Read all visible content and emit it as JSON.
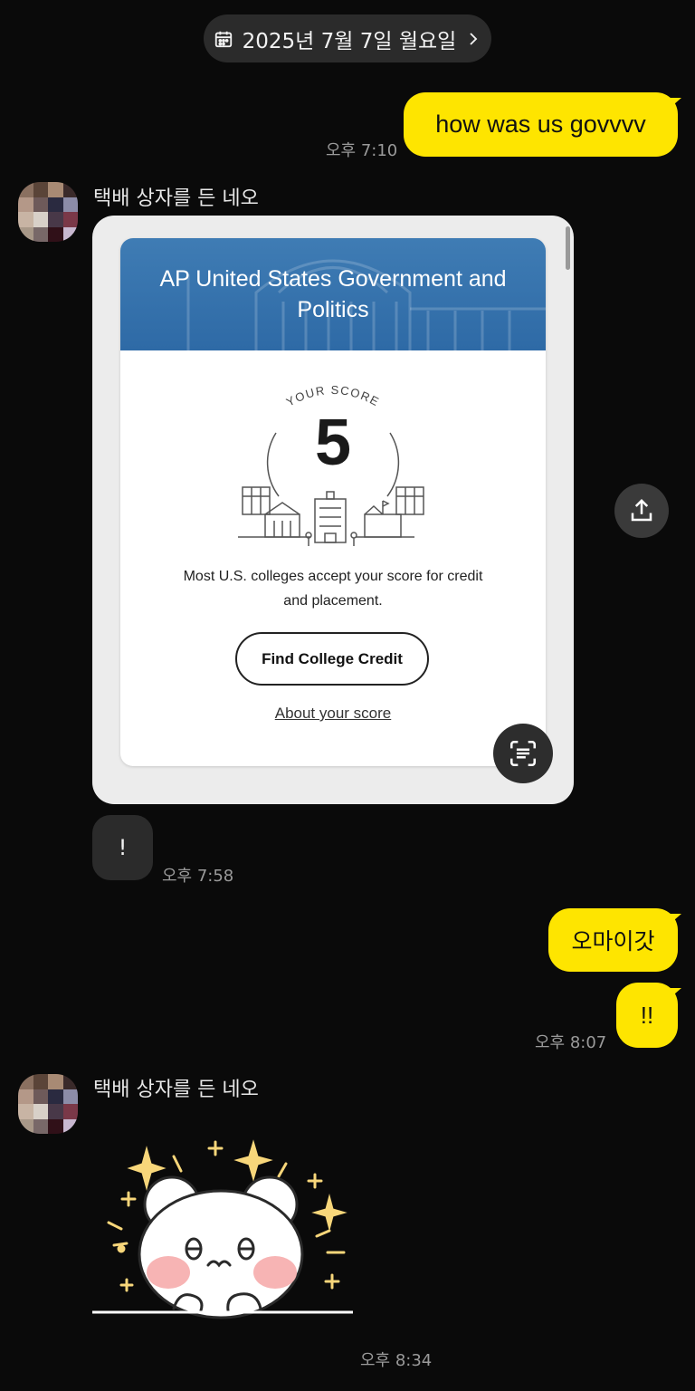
{
  "date_divider": {
    "label": "2025년 7월 7일 월요일",
    "icon": "calendar-icon",
    "chevron": "chevron-right-icon"
  },
  "messages": [
    {
      "type": "outgoing",
      "text": "how was us govvvv",
      "time": "오후 7:10"
    },
    {
      "type": "incoming-image",
      "sender": "택배 상자를 든 네오",
      "image": {
        "title": "AP United States Government and Politics",
        "score_label": "YOUR SCORE",
        "score": "5",
        "description": "Most U.S. colleges accept your score for credit and placement.",
        "button_label": "Find College Credit",
        "link_label": "About your score"
      }
    },
    {
      "type": "incoming",
      "text": "!",
      "time": "오후 7:58"
    },
    {
      "type": "outgoing",
      "text": "오마이갓"
    },
    {
      "type": "outgoing",
      "text": "!!",
      "time": "오후 8:07"
    },
    {
      "type": "incoming-sticker",
      "sender": "택배 상자를 든 네오",
      "sticker": "sparkling-bear-sticker",
      "time": "오후 8:34"
    }
  ],
  "colors": {
    "background": "#0a0a0a",
    "outgoing_bubble": "#fee500",
    "incoming_bubble": "#2b2b2b",
    "ap_header": "#2e6aa6"
  }
}
